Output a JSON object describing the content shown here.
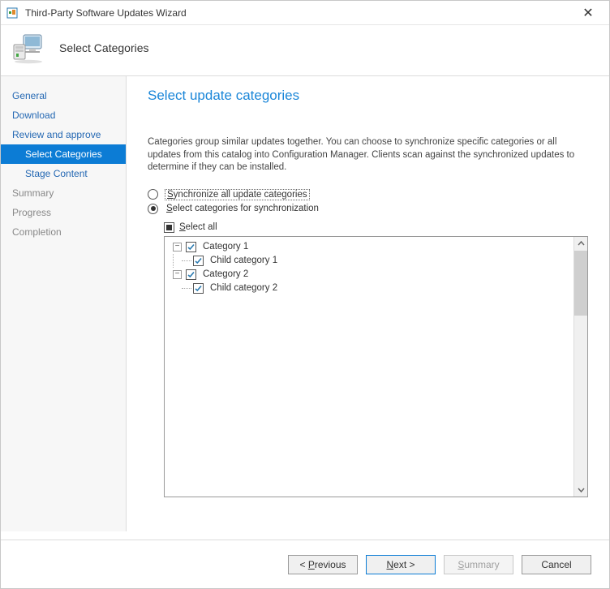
{
  "window": {
    "title": "Third-Party Software Updates Wizard"
  },
  "header": {
    "step_title": "Select Categories"
  },
  "sidebar": {
    "items": [
      {
        "label": "General"
      },
      {
        "label": "Download"
      },
      {
        "label": "Review and approve"
      },
      {
        "label": "Select Categories"
      },
      {
        "label": "Stage Content"
      },
      {
        "label": "Summary"
      },
      {
        "label": "Progress"
      },
      {
        "label": "Completion"
      }
    ]
  },
  "page": {
    "title": "Select update categories",
    "description": "Categories group similar updates together. You can choose to synchronize specific categories or all updates from this catalog into Configuration Manager. Clients scan against the synchronized updates to determine if they can be installed.",
    "radio_all_prefix": "S",
    "radio_all_rest": "ynchronize all update categories",
    "radio_select_prefix": "S",
    "radio_select_rest": "elect categories for synchronization",
    "select_all_prefix": "S",
    "select_all_rest": "elect all",
    "tree": [
      {
        "label": "Category 1",
        "children": [
          {
            "label": "Child category 1"
          }
        ]
      },
      {
        "label": "Category 2",
        "children": [
          {
            "label": "Child category 2"
          }
        ]
      }
    ]
  },
  "footer": {
    "previous_prefix": "P",
    "previous_rest": "revious",
    "next_prefix": "N",
    "next_rest": "ext",
    "summary_prefix": "S",
    "summary_rest": "ummary",
    "cancel": "Cancel"
  }
}
